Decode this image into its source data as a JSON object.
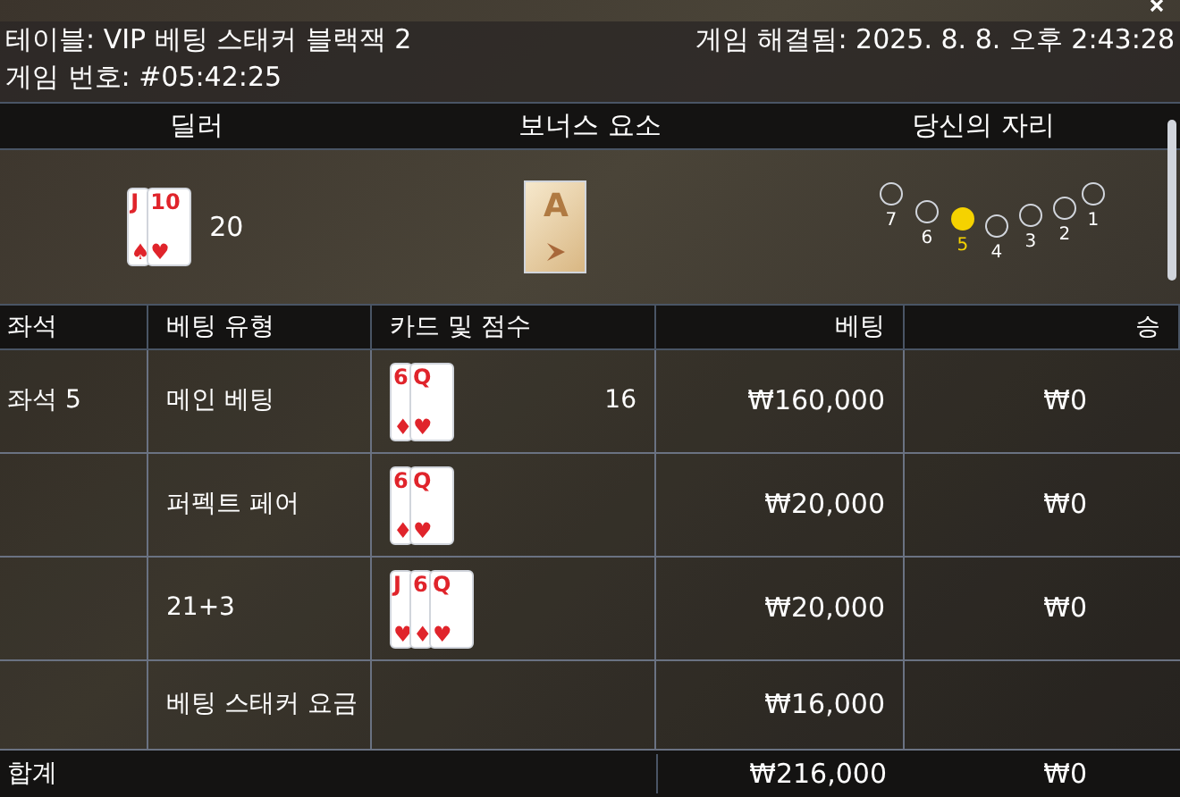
{
  "header": {
    "table": "테이블: VIP 베팅 스태커 블랙잭 2",
    "resolved": "게임 해결됨: 2025. 8. 8. 오후 2:43:28",
    "game_number": "게임 번호: #05:42:25"
  },
  "sections": [
    "딜러",
    "보너스 요소",
    "당신의 자리"
  ],
  "dealer": {
    "cards": [
      {
        "rank": "J",
        "suit": "♠"
      },
      {
        "rank": "10",
        "suit": "♥"
      }
    ],
    "score": "20"
  },
  "bonus": {
    "cards": [
      {
        "rank": "A"
      }
    ]
  },
  "seats": [
    {
      "label": "7",
      "selected": false
    },
    {
      "label": "6",
      "selected": false
    },
    {
      "label": "5",
      "selected": true
    },
    {
      "label": "4",
      "selected": false
    },
    {
      "label": "3",
      "selected": false
    },
    {
      "label": "2",
      "selected": false
    },
    {
      "label": "1",
      "selected": false
    }
  ],
  "table": {
    "columns": [
      "좌석",
      "베팅 유형",
      "카드 및 점수",
      "베팅",
      "승"
    ],
    "rows": [
      {
        "seat": "좌석 5",
        "type": "메인 베팅",
        "cards": [
          {
            "rank": "6",
            "suit": "♦"
          },
          {
            "rank": "Q",
            "suit": "♥"
          }
        ],
        "score": "16",
        "bet": "₩160,000",
        "win": "₩0"
      },
      {
        "type": "퍼펙트 페어",
        "cards": [
          {
            "rank": "6",
            "suit": "♦"
          },
          {
            "rank": "Q",
            "suit": "♥"
          }
        ],
        "bet": "₩20,000",
        "win": "₩0"
      },
      {
        "type": "21+3",
        "cards": [
          {
            "rank": "J",
            "suit": "♥"
          },
          {
            "rank": "6",
            "suit": "♦"
          },
          {
            "rank": "Q",
            "suit": "♥"
          }
        ],
        "bet": "₩20,000",
        "win": "₩0"
      },
      {
        "type": "베팅 스태커 요금",
        "bet": "₩16,000"
      }
    ],
    "total": {
      "label": "합계",
      "bet": "₩216,000",
      "win": "₩0"
    }
  }
}
